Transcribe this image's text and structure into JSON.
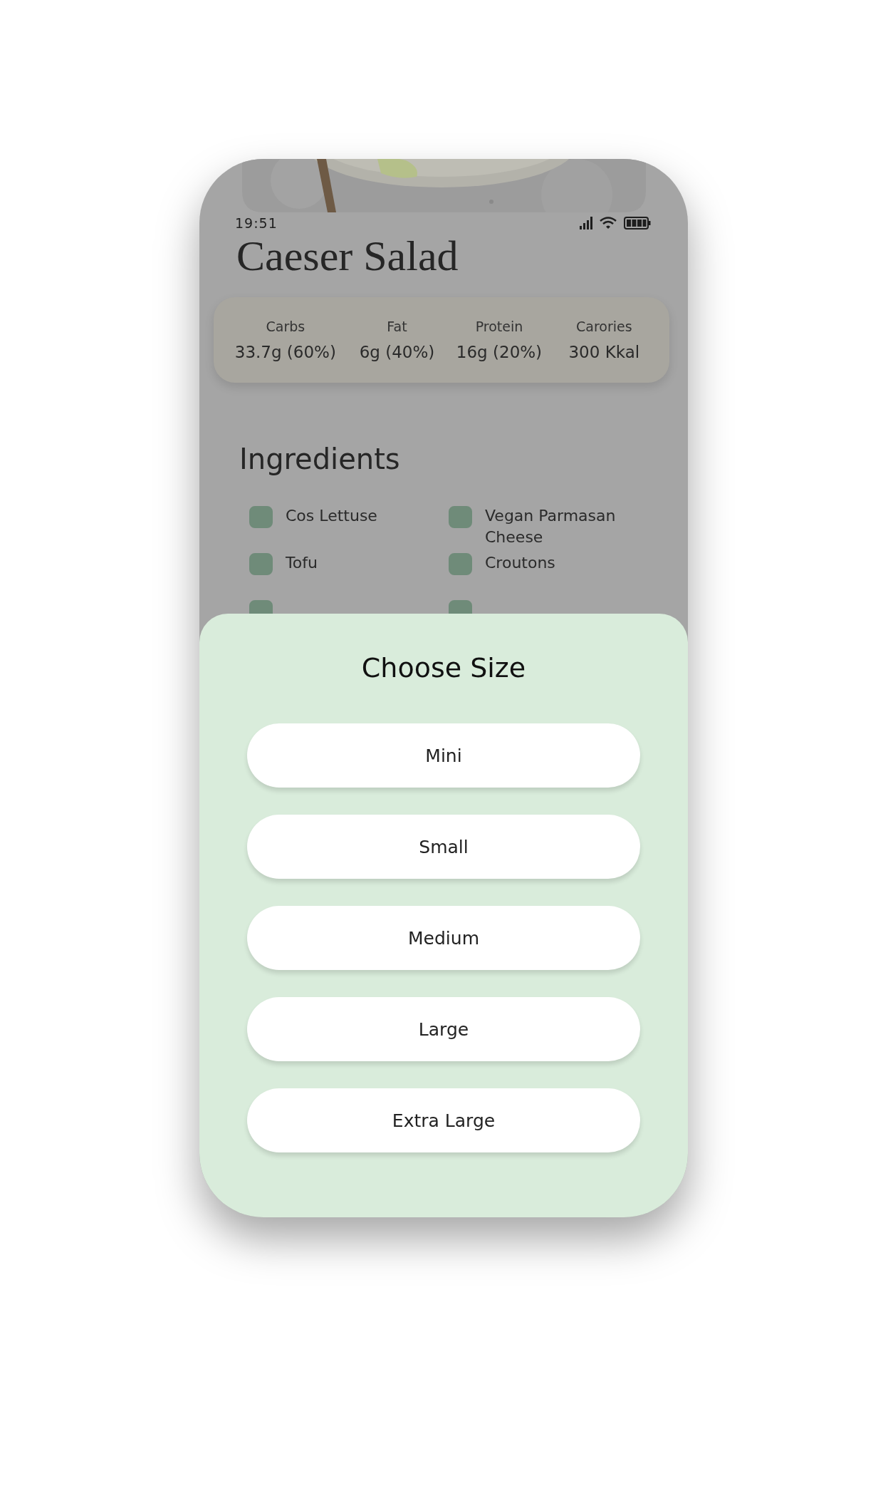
{
  "status_bar": {
    "time": "19:51"
  },
  "title": "Caeser Salad",
  "nutrition": [
    {
      "label": "Carbs",
      "value": "33.7g (60%)"
    },
    {
      "label": "Fat",
      "value": "6g (40%)"
    },
    {
      "label": "Protein",
      "value": "16g (20%)"
    },
    {
      "label": "Carories",
      "value": "300 Kkal"
    }
  ],
  "ingredients": {
    "heading": "Ingredients",
    "items": [
      {
        "label": "Cos Lettuse",
        "checked": true
      },
      {
        "label": "Vegan Parmasan Cheese",
        "checked": true
      },
      {
        "label": "Tofu",
        "checked": true
      },
      {
        "label": "Croutons",
        "checked": true
      },
      {
        "checked": true
      },
      {
        "checked": true
      }
    ]
  },
  "sheet": {
    "title": "Choose Size",
    "options": [
      "Mini",
      "Small",
      "Medium",
      "Large",
      "Extra Large"
    ]
  }
}
